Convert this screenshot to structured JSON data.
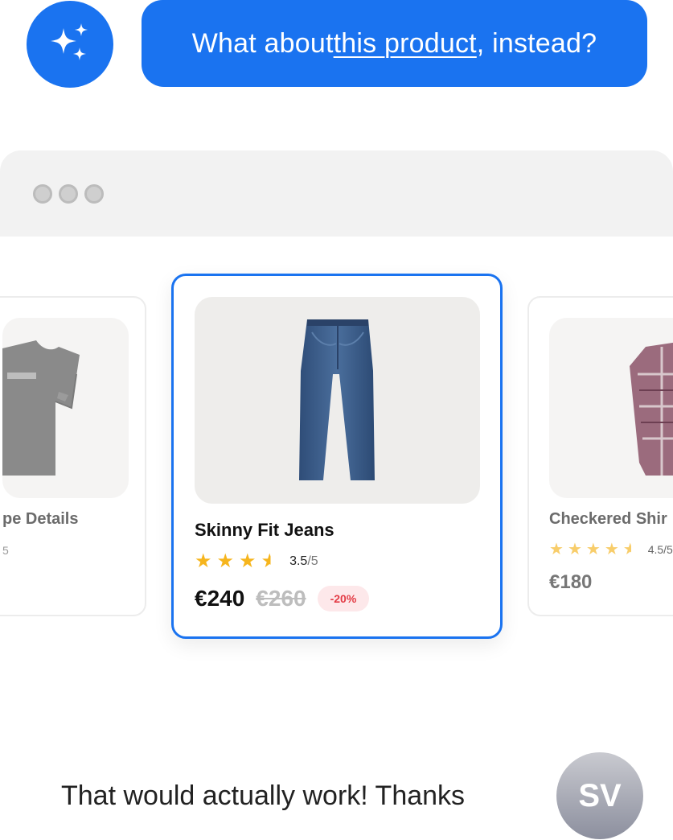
{
  "assistant": {
    "avatar_icon": "sparkles-icon",
    "message_before": "What about ",
    "message_link": "this product",
    "message_after": ", instead?"
  },
  "browser": {
    "window_controls": [
      "dot",
      "dot",
      "dot"
    ]
  },
  "products": {
    "left": {
      "title": "pe Details",
      "sub": "5"
    },
    "main": {
      "title": "Skinny Fit Jeans",
      "rating": "3.5",
      "rating_max": "/5",
      "price": "€240",
      "old_price": "€260",
      "discount": "-20%"
    },
    "right": {
      "title": "Checkered Shir",
      "rating": "4.5/",
      "rating_max": "5",
      "price": "€180"
    }
  },
  "user": {
    "message": "That would actually work! Thanks",
    "initials": "SV"
  },
  "colors": {
    "accent": "#1a73f0",
    "star": "#f6b51d",
    "discount_text": "#e33b45",
    "discount_bg": "#fde8ea"
  }
}
